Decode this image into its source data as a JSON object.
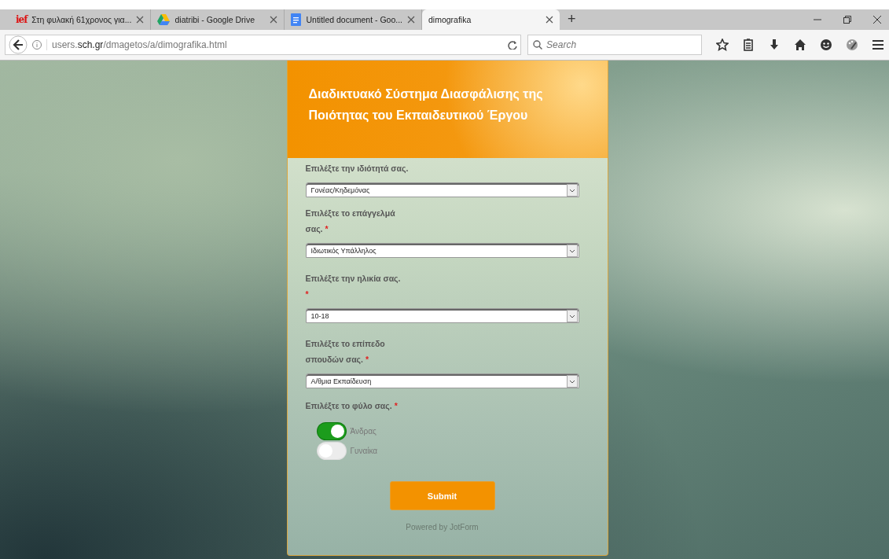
{
  "browser": {
    "tabs": [
      {
        "title": "Στη φυλακή 61χρονος για...",
        "kind": "logo",
        "icon_text": "ief",
        "selected": false
      },
      {
        "title": "diatribi - Google Drive",
        "kind": "drive",
        "selected": false
      },
      {
        "title": "Untitled document - Goo...",
        "kind": "document",
        "selected": false
      },
      {
        "title": "dimografika",
        "kind": "plain",
        "selected": true
      }
    ],
    "new_tab": "+",
    "address": "users.**sch.gr**/dmagetos/a/dimografika.html",
    "search": {
      "placeholder": "Search"
    }
  },
  "form": {
    "title": "Διαδικτυακό Σύστημα Διασφάλισης της Ποιότητας του Εκπαιδευτικού Έργου",
    "questions": [
      {
        "kind": "select",
        "label": [
          "Επιλέξτε την ιδιότητά σας."
        ],
        "value": "Γονέας/Κηδεμόνας"
      },
      {
        "kind": "select",
        "label": [
          "Επιλέξτε το επάγγελμά",
          "σας."
        ],
        "required_mark": "*",
        "value": "Ιδιωτικός Υπάλληλος"
      },
      {
        "kind": "select",
        "label": [
          "Επιλέξτε την ηλικία σας."
        ],
        "required_mark": "*",
        "mark_wrapped": true,
        "value": "10-18"
      },
      {
        "kind": "select",
        "label": [
          "Επιλέξτε το επίπεδο",
          "σπουδών σας."
        ],
        "required_mark": "*",
        "value": "Α/θμια Εκπαίδευση"
      },
      {
        "kind": "toggle",
        "label": [
          "Επιλέξτε το φύλο σας."
        ],
        "required_mark": "*",
        "options": [
          {
            "label": "Άνδρας",
            "selected": true
          },
          {
            "label": "Γυναίκα",
            "selected": false
          }
        ]
      }
    ],
    "submit": "Submit",
    "footer": "Powered by JotForm"
  }
}
